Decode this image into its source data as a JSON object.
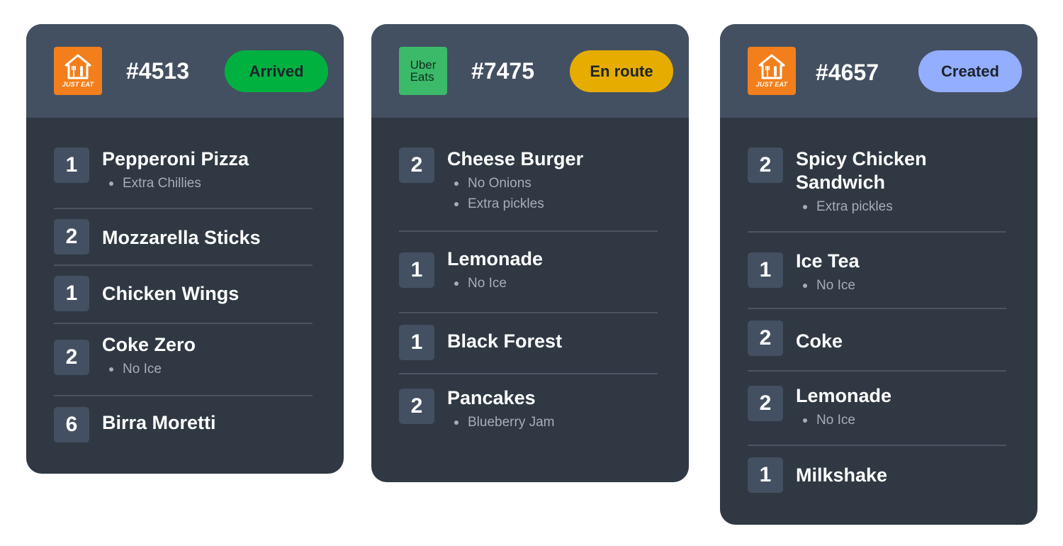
{
  "orders": [
    {
      "platform": "Just Eat",
      "logo_text": "JUST EAT",
      "number": "#4513",
      "status": "Arrived",
      "status_color": "#00b140",
      "items": [
        {
          "qty": "1",
          "name": "Pepperoni Pizza",
          "mods": [
            "Extra Chillies"
          ]
        },
        {
          "qty": "2",
          "name": "Mozzarella Sticks",
          "mods": []
        },
        {
          "qty": "1",
          "name": "Chicken Wings",
          "mods": []
        },
        {
          "qty": "2",
          "name": "Coke Zero",
          "mods": [
            "No Ice"
          ]
        },
        {
          "qty": "6",
          "name": "Birra Moretti",
          "mods": []
        }
      ]
    },
    {
      "platform": "Uber Eats",
      "logo_line1": "Uber",
      "logo_line2": "Eats",
      "number": "#7475",
      "status": "En route",
      "status_color": "#e6ad00",
      "items": [
        {
          "qty": "2",
          "name": "Cheese Burger",
          "mods": [
            "No Onions",
            "Extra pickles"
          ]
        },
        {
          "qty": "1",
          "name": "Lemonade",
          "mods": [
            "No Ice"
          ]
        },
        {
          "qty": "1",
          "name": "Black Forest",
          "mods": []
        },
        {
          "qty": "2",
          "name": "Pancakes",
          "mods": [
            "Blueberry Jam"
          ]
        }
      ]
    },
    {
      "platform": "Just Eat",
      "logo_text": "JUST EAT",
      "number": "#4657",
      "status": "Created",
      "status_color": "#93aeff",
      "items": [
        {
          "qty": "2",
          "name": "Spicy Chicken Sandwich",
          "mods": [
            "Extra pickles"
          ]
        },
        {
          "qty": "1",
          "name": "Ice Tea",
          "mods": [
            "No Ice"
          ]
        },
        {
          "qty": "2",
          "name": "Coke",
          "mods": []
        },
        {
          "qty": "2",
          "name": "Lemonade",
          "mods": [
            "No Ice"
          ]
        },
        {
          "qty": "1",
          "name": "Milkshake",
          "mods": []
        }
      ]
    }
  ],
  "icons": {
    "just_eat": "house-cutlery-icon",
    "uber_eats": "uber-eats-wordmark"
  }
}
